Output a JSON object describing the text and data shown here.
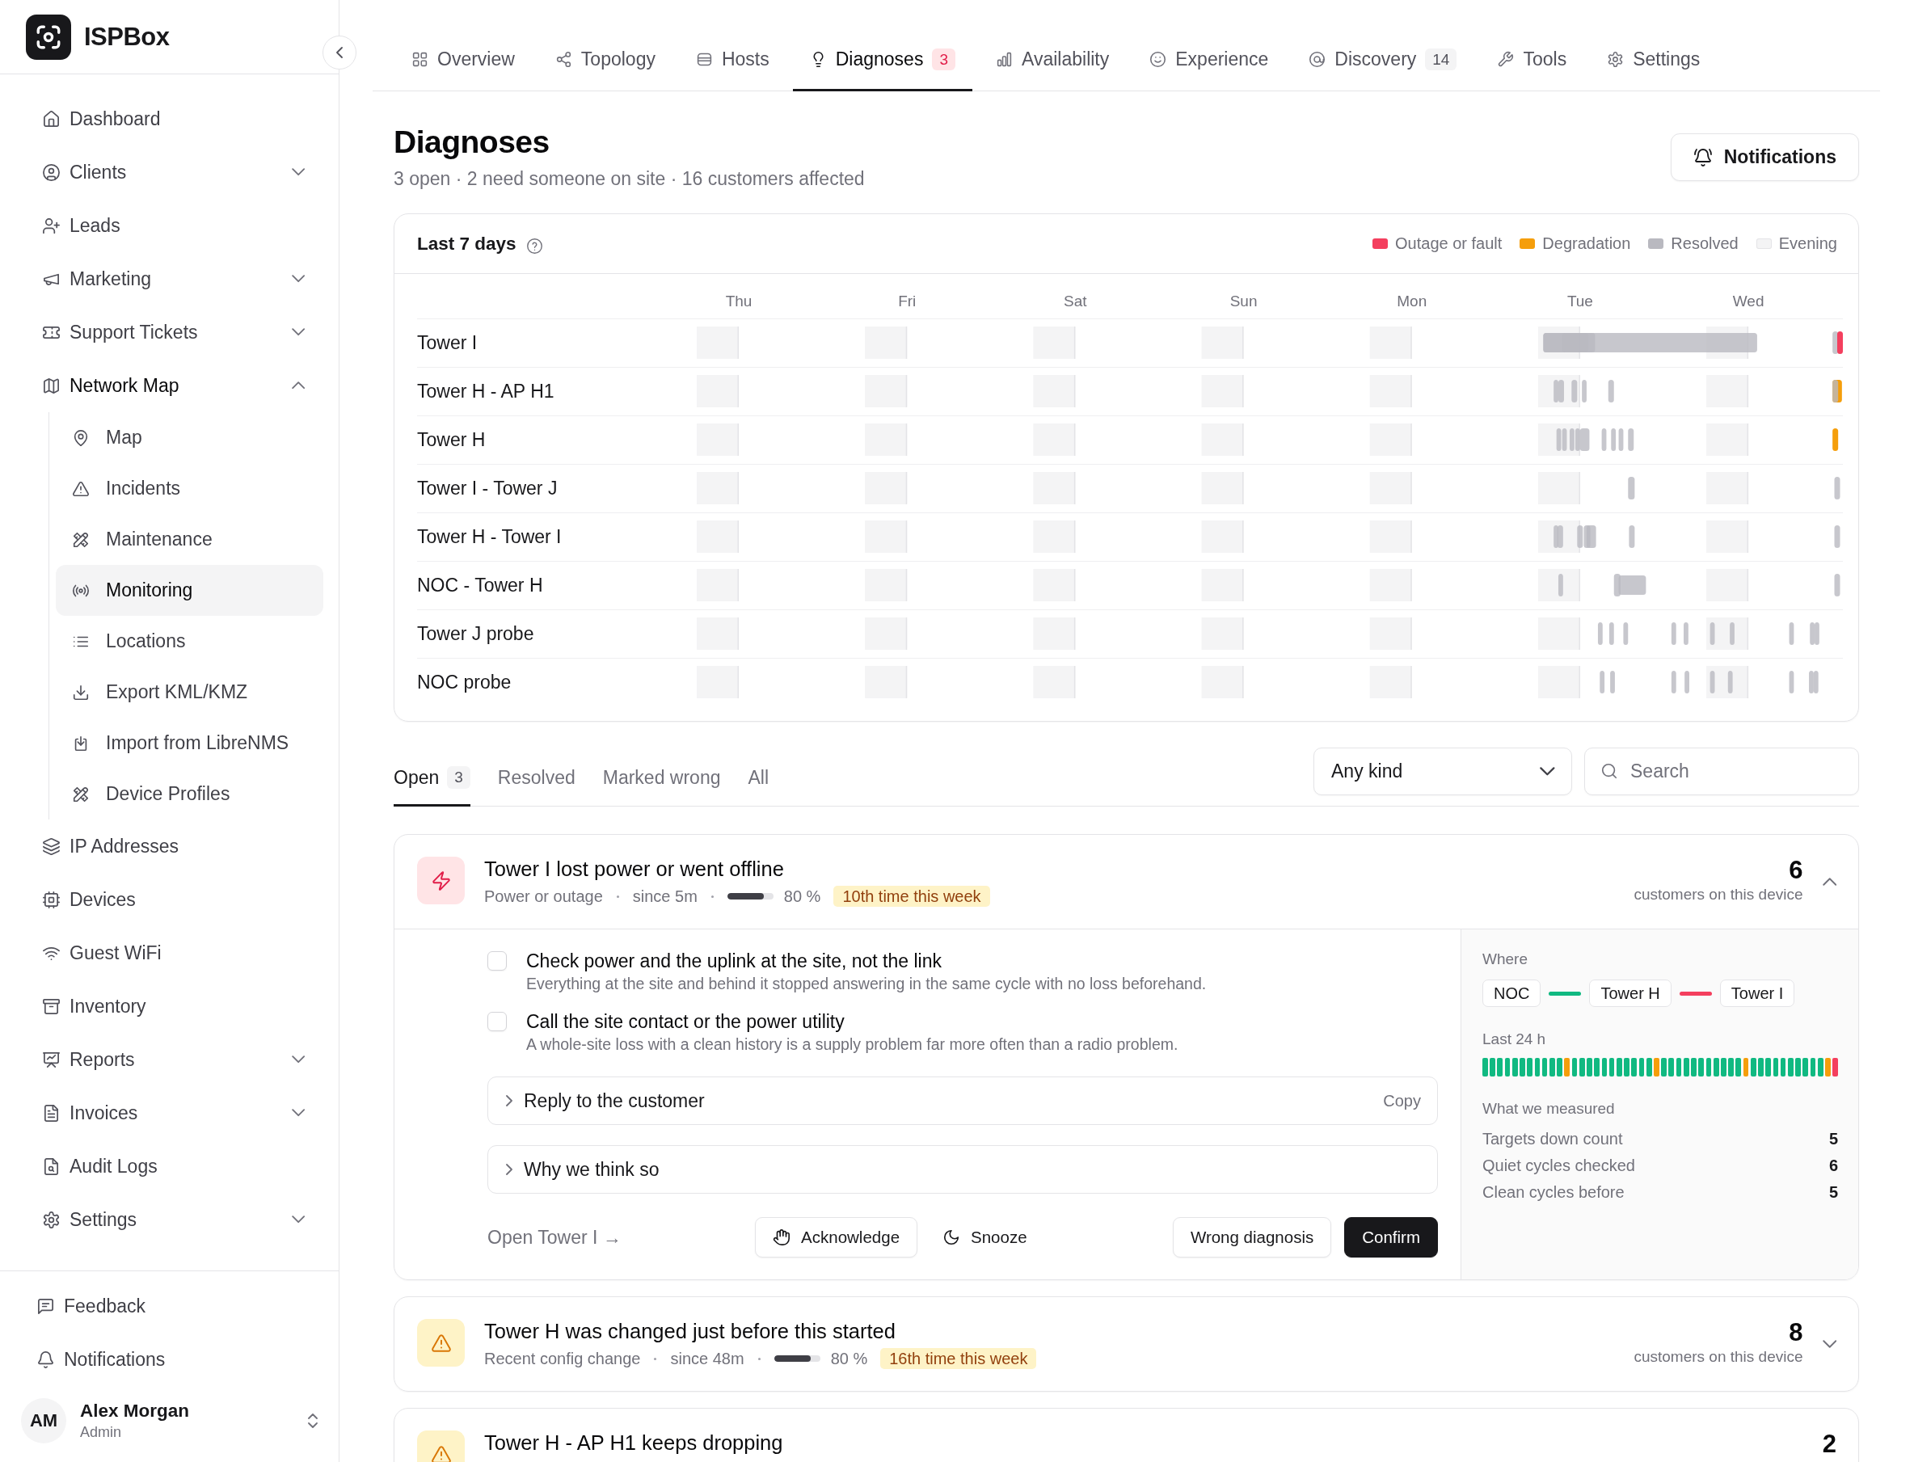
{
  "sidebar": {
    "brand": "ISPBox",
    "items": [
      {
        "kind": "link",
        "label": "Dashboard",
        "selected": false
      },
      {
        "kind": "group",
        "label": "Clients",
        "selected": false,
        "expanded": false
      },
      {
        "kind": "link",
        "label": "Leads",
        "selected": false
      },
      {
        "kind": "group",
        "label": "Marketing",
        "selected": false,
        "expanded": false
      },
      {
        "kind": "group",
        "label": "Support Tickets",
        "selected": false,
        "expanded": false
      },
      {
        "kind": "group",
        "label": "Network Map",
        "selected": false,
        "expanded": true,
        "children": [
          {
            "label": "Map",
            "selected": false
          },
          {
            "label": "Incidents",
            "selected": false
          },
          {
            "label": "Maintenance",
            "selected": false
          },
          {
            "label": "Monitoring",
            "selected": true
          },
          {
            "label": "Locations",
            "selected": false
          },
          {
            "label": "Export KML/KMZ",
            "selected": false
          },
          {
            "label": "Import from LibreNMS",
            "selected": false
          },
          {
            "label": "Device Profiles",
            "selected": false
          }
        ]
      },
      {
        "kind": "link",
        "label": "IP Addresses",
        "selected": false
      },
      {
        "kind": "link",
        "label": "Devices",
        "selected": false
      },
      {
        "kind": "link",
        "label": "Guest WiFi",
        "selected": false
      },
      {
        "kind": "link",
        "label": "Inventory",
        "selected": false
      },
      {
        "kind": "group",
        "label": "Reports",
        "selected": false,
        "expanded": false
      },
      {
        "kind": "group",
        "label": "Invoices",
        "selected": false,
        "expanded": false
      },
      {
        "kind": "link",
        "label": "Audit Logs",
        "selected": false
      },
      {
        "kind": "group",
        "label": "Settings",
        "selected": false,
        "expanded": false
      }
    ],
    "footer_items": [
      {
        "label": "Feedback",
        "selected": false
      },
      {
        "label": "Notifications",
        "selected": false
      }
    ],
    "user": {
      "initials": "AM",
      "name": "Alex Morgan",
      "role": "Admin"
    }
  },
  "tabs": [
    {
      "label": "Overview",
      "selected": false
    },
    {
      "label": "Topology",
      "selected": false
    },
    {
      "label": "Hosts",
      "selected": false
    },
    {
      "label": "Diagnoses",
      "selected": true,
      "badge": {
        "text": "3",
        "kind": "alert"
      }
    },
    {
      "label": "Availability",
      "selected": false
    },
    {
      "label": "Experience",
      "selected": false
    },
    {
      "label": "Discovery",
      "selected": false,
      "badge": {
        "text": "14",
        "kind": "count"
      }
    },
    {
      "label": "Tools",
      "selected": false
    },
    {
      "label": "Settings",
      "selected": false
    }
  ],
  "page": {
    "title": "Diagnoses",
    "subtitle": "3 open · 2 need someone on site · 16 customers affected",
    "button": "Notifications"
  },
  "timeline": {
    "title": "Last 7 days",
    "legend": [
      {
        "label": "Outage or fault",
        "color": "#f43f5e"
      },
      {
        "label": "Degradation",
        "color": "#f59e0b"
      },
      {
        "label": "Resolved",
        "color": "#b9b9c0"
      },
      {
        "label": "Evening",
        "color": "#f4f4f5"
      }
    ],
    "days": [
      "Thu",
      "Fri",
      "Sat",
      "Sun",
      "Mon",
      "Tue",
      "Wed"
    ],
    "rows": [
      "Tower I",
      "Tower H - AP H1",
      "Tower H",
      "Tower I - Tower J",
      "Tower H - Tower I",
      "NOC - Tower H",
      "Tower J probe",
      "NOC probe"
    ]
  },
  "filter_tabs": [
    {
      "label": "Open",
      "selected": true,
      "count": "3"
    },
    {
      "label": "Resolved",
      "selected": false
    },
    {
      "label": "Marked wrong",
      "selected": false
    },
    {
      "label": "All",
      "selected": false
    }
  ],
  "kind_select": {
    "value": "Any kind"
  },
  "search": {
    "placeholder": "Search"
  },
  "diagnoses": [
    {
      "kind": "outage",
      "title": "Tower I lost power or went offline",
      "category": "Power or outage",
      "since": "since 5m",
      "confidence": {
        "level": 0.8,
        "text": "80 %"
      },
      "repeat": "10th time this week",
      "count": "6",
      "count_label": "customers on this device",
      "expanded": true,
      "detail": {
        "steps": [
          {
            "title": "Check power and the uplink at the site, not the link",
            "description": "Everything at the site and behind it stopped answering in the same cycle with no loss beforehand.",
            "checked": false
          },
          {
            "title": "Call the site contact or the power utility",
            "description": "A whole-site loss with a clean history is a supply problem far more often than a radio problem.",
            "checked": false
          }
        ],
        "sections": [
          {
            "label": "Reply to the customer",
            "action": "Copy",
            "expanded": false
          },
          {
            "label": "Why we think so",
            "expanded": false
          }
        ],
        "open_link": "Open Tower I →",
        "triage_actions": [
          {
            "label": "Acknowledge",
            "kind": "outline"
          },
          {
            "label": "Snooze",
            "kind": "ghost"
          }
        ],
        "verdict_actions": [
          {
            "label": "Wrong diagnosis",
            "kind": "outline"
          },
          {
            "label": "Confirm",
            "kind": "primary"
          }
        ],
        "where": {
          "label": "Where",
          "path": [
            {
              "kind": "node",
              "label": "NOC"
            },
            {
              "kind": "link",
              "color": "#10b981"
            },
            {
              "kind": "node",
              "label": "Tower H"
            },
            {
              "kind": "link",
              "color": "#f43f5e"
            },
            {
              "kind": "node",
              "label": "Tower I"
            }
          ]
        },
        "history": {
          "label": "Last 24 h",
          "slots": [
            {
              "color": "#10b981"
            },
            {
              "color": "#10b981"
            },
            {
              "color": "#10b981"
            },
            {
              "color": "#10b981"
            },
            {
              "color": "#10b981"
            },
            {
              "color": "#10b981"
            },
            {
              "color": "#10b981"
            },
            {
              "color": "#10b981"
            },
            {
              "color": "#10b981"
            },
            {
              "color": "#10b981"
            },
            {
              "color": "#10b981"
            },
            {
              "color": "#f59e0b"
            },
            {
              "color": "#10b981"
            },
            {
              "color": "#10b981"
            },
            {
              "color": "#10b981"
            },
            {
              "color": "#10b981"
            },
            {
              "color": "#10b981"
            },
            {
              "color": "#10b981"
            },
            {
              "color": "#10b981"
            },
            {
              "color": "#10b981"
            },
            {
              "color": "#10b981"
            },
            {
              "color": "#10b981"
            },
            {
              "color": "#10b981"
            },
            {
              "color": "#f59e0b"
            },
            {
              "color": "#10b981"
            },
            {
              "color": "#10b981"
            },
            {
              "color": "#10b981"
            },
            {
              "color": "#10b981"
            },
            {
              "color": "#10b981"
            },
            {
              "color": "#10b981"
            },
            {
              "color": "#10b981"
            },
            {
              "color": "#10b981"
            },
            {
              "color": "#10b981"
            },
            {
              "color": "#10b981"
            },
            {
              "color": "#10b981"
            },
            {
              "color": "#f59e0b"
            },
            {
              "color": "#10b981"
            },
            {
              "color": "#10b981"
            },
            {
              "color": "#10b981"
            },
            {
              "color": "#10b981"
            },
            {
              "color": "#10b981"
            },
            {
              "color": "#10b981"
            },
            {
              "color": "#10b981"
            },
            {
              "color": "#10b981"
            },
            {
              "color": "#10b981"
            },
            {
              "color": "#10b981"
            },
            {
              "color": "#f59e0b"
            },
            {
              "color": "#f43f5e"
            }
          ]
        },
        "measured": {
          "label": "What we measured",
          "rows": [
            {
              "label": "Targets down count",
              "value": "5"
            },
            {
              "label": "Quiet cycles checked",
              "value": "6"
            },
            {
              "label": "Clean cycles before",
              "value": "5"
            }
          ]
        }
      }
    },
    {
      "kind": "warning",
      "title": "Tower H was changed just before this started",
      "category": "Recent config change",
      "since": "since 48m",
      "confidence": {
        "level": 0.8,
        "text": "80 %"
      },
      "repeat": "16th time this week",
      "count": "8",
      "count_label": "customers on this device",
      "expanded": false
    },
    {
      "kind": "warning",
      "title": "Tower H - AP H1 keeps dropping",
      "count": "2"
    }
  ]
}
